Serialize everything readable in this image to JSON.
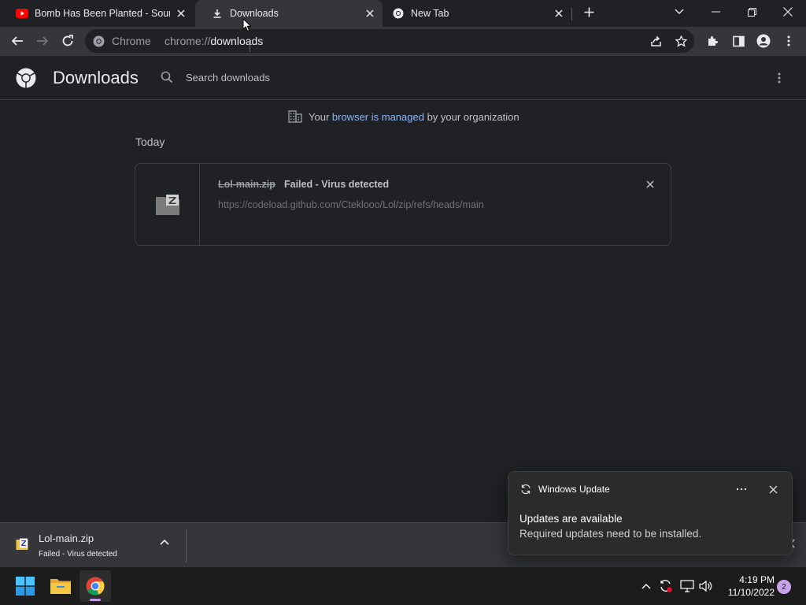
{
  "browser": {
    "tabs": [
      {
        "title": "Bomb Has Been Planted - Sound",
        "favicon": "youtube-icon",
        "active": false
      },
      {
        "title": "Downloads",
        "favicon": "download-icon",
        "active": true
      },
      {
        "title": "New Tab",
        "favicon": "chrome-icon",
        "active": false
      }
    ],
    "omnibox": {
      "chip_label": "Chrome",
      "url_scheme": "chrome://",
      "url_host": "downloads"
    }
  },
  "page": {
    "title": "Downloads",
    "search_placeholder": "Search downloads",
    "managed": {
      "prefix": "Your ",
      "link": "browser is managed",
      "suffix": " by your organization"
    },
    "section": "Today",
    "downloads": [
      {
        "filename": "Lol-main.zip",
        "status": "Failed - Virus detected",
        "source_url": "https://codeload.github.com/Cteklooo/Lol/zip/refs/heads/main",
        "icon": "zip-file-icon"
      }
    ]
  },
  "shelf": {
    "filename": "Lol-main.zip",
    "status": "Failed - Virus detected"
  },
  "toast": {
    "app_name": "Windows Update",
    "heading": "Updates are available",
    "body": "Required updates need to be installed."
  },
  "taskbar": {
    "apps": [
      "start-icon",
      "file-explorer-icon",
      "chrome-icon"
    ],
    "time": "4:19 PM",
    "date": "11/10/2022",
    "notification_count": "2"
  },
  "colors": {
    "background": "#202124",
    "toolbar": "#35363a",
    "link": "#8ab4f8",
    "youtube_red": "#ff0000",
    "notif_badge": "#c8a2e8"
  }
}
